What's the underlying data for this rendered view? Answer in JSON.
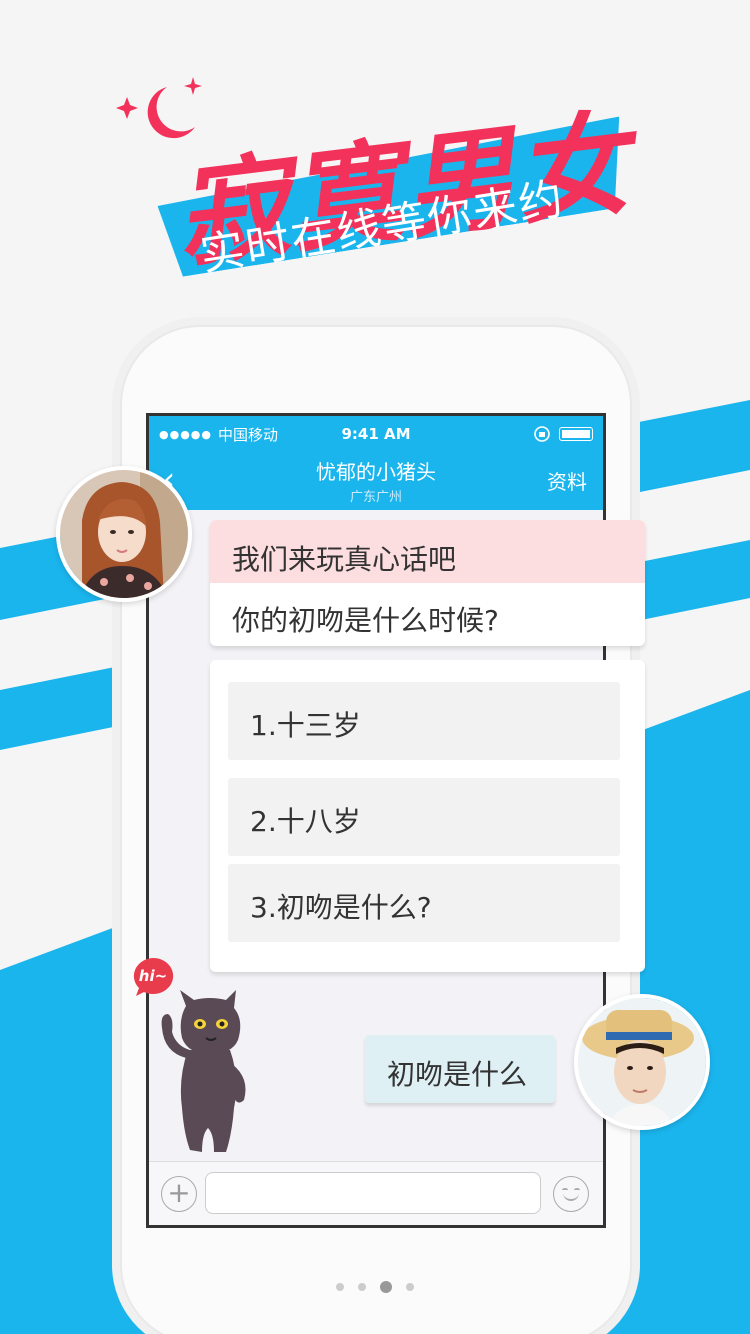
{
  "headline": {
    "title": "寂寞男女",
    "subtitle": "实时在线等你来约"
  },
  "status_bar": {
    "signal": "●●●●●",
    "carrier": "中国移动",
    "time": "9:41 AM"
  },
  "nav": {
    "back_icon": "‹",
    "title": "忧郁的小猪头",
    "location": "广东广州",
    "profile_label": "资料"
  },
  "chat": {
    "question_header": "我们来玩真心话吧",
    "question": "你的初吻是什么时候?",
    "options": [
      "1.十三岁",
      "2.十八岁",
      "3.初吻是什么?"
    ],
    "reply": "初吻是什么",
    "sticker_text": "hi~"
  },
  "input_bar": {
    "plus_icon": "+",
    "placeholder": ""
  },
  "pager": {
    "count": 4,
    "active_index": 2
  },
  "colors": {
    "accent_blue": "#1bb5ee",
    "headline_red": "#f2325a",
    "question_pink": "#fcdde0",
    "reply_blue": "#dff0f5"
  }
}
